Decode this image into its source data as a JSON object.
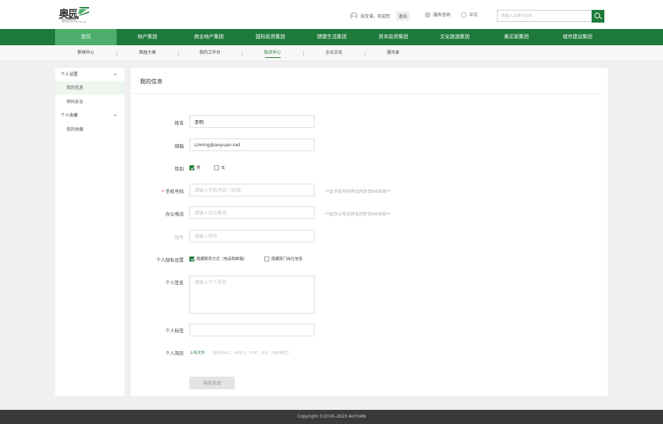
{
  "brand": {
    "name": "奥园",
    "tagline_cn": "美好生活缔造者",
    "tagline_en": "CREATOR OF A BETTER LIFE",
    "green": "#1e7a3a",
    "light_green": "#4cae6a"
  },
  "header": {
    "welcome": "张宝谋，欢迎您",
    "logout": "退出",
    "service": "服务咨询",
    "language": "中文",
    "search_placeholder": "请输入关键字检索",
    "search_icon": "search-icon",
    "avatar_icon": "avatar-icon"
  },
  "nav": {
    "items": [
      {
        "label": "首页",
        "active": true
      },
      {
        "label": "地产集团"
      },
      {
        "label": "商业地产集团"
      },
      {
        "label": "国际投资集团"
      },
      {
        "label": "健康生活集团"
      },
      {
        "label": "资本投资集团"
      },
      {
        "label": "文化旅游集团"
      },
      {
        "label": "奥买家集团"
      },
      {
        "label": "城市建设集团"
      }
    ]
  },
  "subnav": {
    "items": [
      {
        "label": "新闻中心"
      },
      {
        "label": "奥园大咖"
      },
      {
        "label": "我的工作台"
      },
      {
        "label": "知识中心",
        "active": true
      },
      {
        "label": "企业文化"
      },
      {
        "label": "通讯录"
      }
    ]
  },
  "sidebar": {
    "groups": [
      {
        "label": "个人设置",
        "items": [
          {
            "label": "我的信息",
            "active": true
          },
          {
            "label": "密码安全"
          }
        ]
      },
      {
        "label": "个人收藏",
        "items": [
          {
            "label": "我的收藏"
          }
        ]
      }
    ]
  },
  "form": {
    "title": "我的信息",
    "name_label": "姓名",
    "name_value": "李明",
    "email_label": "邮箱",
    "email_value": "Liming@aoyuan.net",
    "gender_label": "性别",
    "gender_male": "男",
    "gender_female": "女",
    "gender_male_checked": true,
    "gender_female_checked": false,
    "mobile_required": "*",
    "mobile_label": "手机号码",
    "mobile_placeholder": "请输入手机号码（必填）",
    "mobile_hint": "**此手机号码将会同步到HR系统**",
    "office_label": "办公电话",
    "office_placeholder": "请输入办公电话",
    "office_hint": "**此办公电话将会同步到HR系统**",
    "short_label": "短号",
    "short_placeholder": "请输入短号",
    "privacy_label": "个人隐私设置",
    "privacy_hide_contact": "隐藏联系方式（电话和邮箱）",
    "privacy_hide_contact_checked": true,
    "privacy_hide_dept": "隐藏部门岗位信息",
    "privacy_hide_dept_checked": false,
    "signature_label": "个人签名",
    "signature_placeholder": "请输入个人签名",
    "tags_label": "个人标签",
    "tags_value": "",
    "resume_label": "个人简历",
    "upload_label": "上传文件",
    "upload_note": "（支持DOC、DOCX、PDF、JPG、PNG格式）",
    "save_label": "保存更改"
  },
  "footer": {
    "copyright": "Copyright ©2016–2020 AoYUAN"
  }
}
